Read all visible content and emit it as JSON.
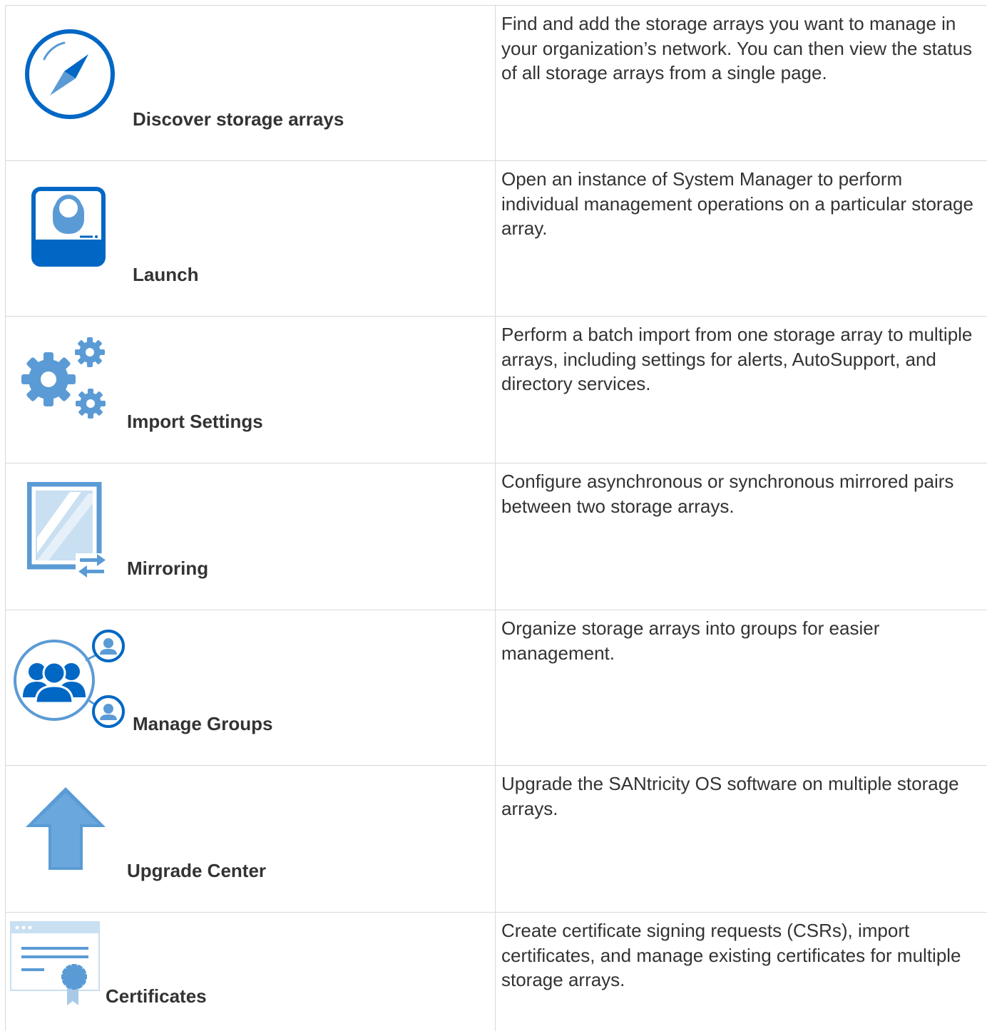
{
  "features": [
    {
      "icon": "compass-icon",
      "title": "Discover storage arrays",
      "description": "Find and add the storage arrays you want to manage in your organization’s network. You can then view the status of all storage arrays from a single page."
    },
    {
      "icon": "system-manager-icon",
      "title": "Launch",
      "description": "Open an instance of System Manager to perform individual management operations on a particular storage array."
    },
    {
      "icon": "gears-icon",
      "title": "Import Settings",
      "description": "Perform a batch import from one storage array to multiple arrays, including settings for alerts, AutoSupport, and directory services."
    },
    {
      "icon": "mirror-icon",
      "title": "Mirroring",
      "description": "Configure asynchronous or synchronous mirrored pairs between two storage arrays."
    },
    {
      "icon": "user-group-icon",
      "title": "Manage Groups",
      "description": "Organize storage arrays into groups for easier management."
    },
    {
      "icon": "up-arrow-icon",
      "title": "Upgrade Center",
      "description": "Upgrade the SANtricity OS software on multiple storage arrays."
    },
    {
      "icon": "certificate-icon",
      "title": "Certificates",
      "description": "Create certificate signing requests (CSRs), import certificates, and manage existing certificates for multiple storage arrays."
    }
  ],
  "colors": {
    "primary_blue": "#0067c5",
    "light_blue": "#5b9bd5",
    "pale_blue": "#c9dff2",
    "border": "#d9d9d9",
    "text": "#333333"
  }
}
